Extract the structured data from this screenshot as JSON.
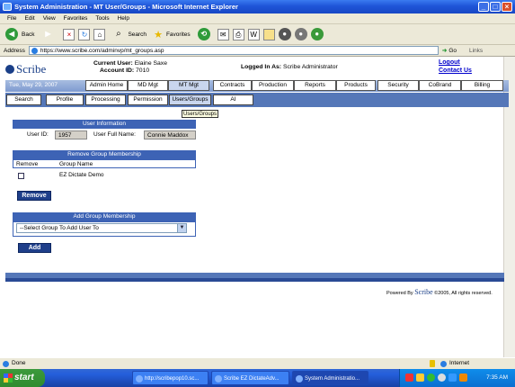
{
  "window": {
    "title": "System Administration - MT User/Groups - Microsoft Internet Explorer"
  },
  "menu": [
    "File",
    "Edit",
    "View",
    "Favorites",
    "Tools",
    "Help"
  ],
  "toolbar": {
    "back": "Back",
    "search": "Search",
    "favorites": "Favorites"
  },
  "address": {
    "label": "Address",
    "url": "https://www.scribe.com/adminvp/mt_groups.asp",
    "go": "Go",
    "links": "Links"
  },
  "header": {
    "logo": "Scribe",
    "current_user_label": "Current User:",
    "current_user": "Elaine Saxe",
    "account_label": "Account ID:",
    "account_id": "7010",
    "logged_in_label": "Logged In As:",
    "logged_in": "Scribe Administrator",
    "logout": "Logout",
    "contact": "Contact Us"
  },
  "date": "Tue, May 29, 2007",
  "nav": [
    "Admin Home",
    "MD Mgt",
    "MT Mgt",
    "Contracts",
    "Production",
    "Reports",
    "Products",
    "Security",
    "CoBrand",
    "Billing"
  ],
  "subnav": [
    "Search",
    "Profile",
    "Processing",
    "Permission",
    "Users/Groups",
    "AI"
  ],
  "tooltip": "Users/Groups",
  "user_info": {
    "heading": "User Information",
    "id_label": "User ID:",
    "id": "1957",
    "name_label": "User Full Name:",
    "name": "Connie Maddox"
  },
  "remove": {
    "heading": "Remove Group Membership",
    "col_remove": "Remove",
    "col_group": "Group Name",
    "groups": [
      "EZ Dictate Demo"
    ],
    "button": "Remove"
  },
  "add": {
    "heading": "Add Group Membership",
    "select": "--Select Group To Add User To",
    "button": "Add"
  },
  "footer": {
    "powered": "Powered By",
    "brand": "Scribe",
    "copyright": "©2005, All rights reserved."
  },
  "status": {
    "text": "Done",
    "zone": "Internet"
  },
  "taskbar": {
    "start": "start",
    "tasks": [
      "http://scribepop10.sc...",
      "Scribe EZ DictateAdv...",
      "System Administratio..."
    ],
    "time": "7:35 AM"
  },
  "colors": {
    "nav_blue": "#5577b8",
    "header_blue": "#3d63b5",
    "button_blue": "#1f3f8a"
  }
}
